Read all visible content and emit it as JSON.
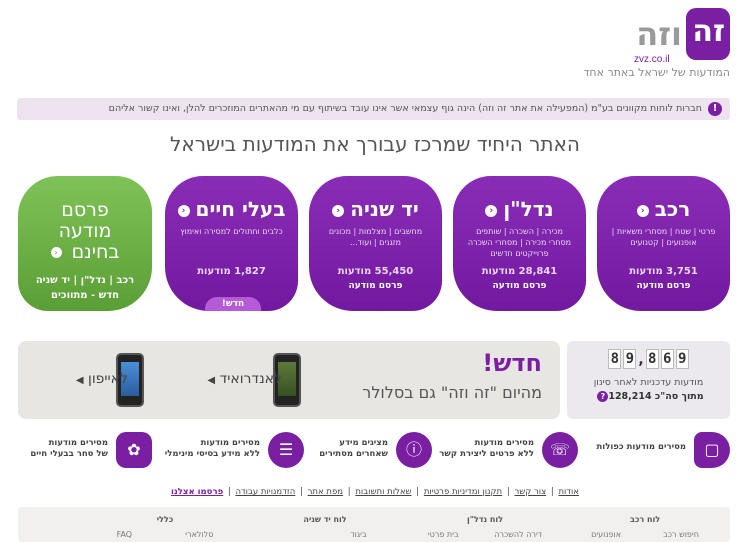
{
  "logo": {
    "mark": "זה",
    "word": "וזה",
    "domain": "zvz.co.il"
  },
  "tagline": "המודעות של ישראל באתר אחד",
  "notice": {
    "text": "חברות לוחות מקוונים בע\"מ (המפעילה את אתר זה וזה) הינה גוף עצמאי אשר אינו עובד בשיתוף עם מי מהאתרים המוזכרים להלן, ואינו קשור אליהם",
    "icon": "!"
  },
  "headline": "האתר היחיד שמרכז עבורך את המודעות בישראל",
  "categories": [
    {
      "title": "רכב",
      "sub": "פרטי | שטח | מסחרי משאיות | אופנועים | קטנועים",
      "count": "3,751 מודעות",
      "post": "פרסם מודעה"
    },
    {
      "title": "נדל\"ן",
      "sub": "מכירה | השכרה | שותפים מסחרי מכירה | מסחרי השכרה פרוייקטים חדשים",
      "count": "28,841 מודעות",
      "post": "פרסם מודעה"
    },
    {
      "title": "יד שניה",
      "sub": "מחשבים | מצלמות | מכונים מזגנים | ועוד...",
      "count": "55,450 מודעות",
      "post": "פרסם מודעה"
    },
    {
      "title": "בעלי חיים",
      "sub": "כלבים וחתולים למסירה ואימוץ",
      "count": "1,827 מודעות",
      "post": "",
      "badge": "חדש!"
    }
  ],
  "free": {
    "line_a": "פרסם",
    "line_b": "מודעה",
    "line_c": "בחינם",
    "sub1": "רכב | נדל\"ן | יד שניה",
    "sub2": "חדש - מתווכים"
  },
  "mobile": {
    "new": "חדש!",
    "sub": "מהיום \"זה וזה\" גם בסלולר",
    "android": "לאנדרואיד",
    "iphone": "לאייפון"
  },
  "counter": {
    "digits": [
      "8",
      "9",
      "8",
      "6",
      "9"
    ],
    "label": "מודעות עדכניות לאחר סינון",
    "total": "מתוך סה\"כ 128,214",
    "icon": "?"
  },
  "features": [
    {
      "text1": "מסירים מודעות כפולות",
      "text2": ""
    },
    {
      "text1": "מסירים מודעות",
      "text2": "ללא פרטים ליצירת קשר"
    },
    {
      "text1": "מציגים מידע",
      "text2": "שאחרים מסתירים"
    },
    {
      "text1": "מסירים מודעות",
      "text2": "ללא מידע בסיסי מינימלי"
    },
    {
      "text1": "מסירים מודעות",
      "text2": "של סחר בבעלי חיים"
    }
  ],
  "links": [
    "אודות",
    "צור קשר",
    "תקנון ומדיניות פרטיות",
    "שאלות ותשובות",
    "מפת אתר",
    "הזדמנויות עבודה",
    "פרסמו אצלנו"
  ],
  "sitemap": [
    {
      "h": "לוח רכב",
      "a": "חיפוש רכב",
      "b": "אופנועים"
    },
    {
      "h": "לוח נדל\"ן",
      "a": "דירה להשכרה",
      "b": "בית פרטי"
    },
    {
      "h": "לוח יד שניה",
      "a": "ביגוד",
      "b": ""
    },
    {
      "h": "כללי",
      "a": "FAQ",
      "b": "סלולארי"
    }
  ],
  "colors": {
    "brand": "#7a1fa2",
    "green": "#5a9e36"
  }
}
